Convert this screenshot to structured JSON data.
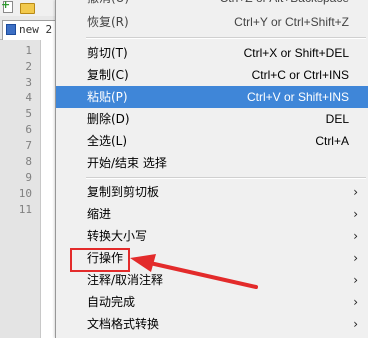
{
  "editor": {
    "tab_title": "new 2",
    "line_numbers": [
      "1",
      "2",
      "3",
      "4",
      "5",
      "6",
      "7",
      "8",
      "9",
      "10",
      "11"
    ]
  },
  "menu": {
    "items": [
      {
        "label": "撤消(U)",
        "shortcut": "Ctrl+Z or Alt+Backspace"
      },
      {
        "label": "恢复(R)",
        "shortcut": "Ctrl+Y or Ctrl+Shift+Z"
      },
      {
        "label": "剪切(T)",
        "shortcut": "Ctrl+X or Shift+DEL"
      },
      {
        "label": "复制(C)",
        "shortcut": "Ctrl+C or Ctrl+INS"
      },
      {
        "label": "粘贴(P)",
        "shortcut": "Ctrl+V or Shift+INS",
        "highlighted": true
      },
      {
        "label": "删除(D)",
        "shortcut": "DEL"
      },
      {
        "label": "全选(L)",
        "shortcut": "Ctrl+A"
      },
      {
        "label": "开始/结束 选择",
        "shortcut": ""
      },
      {
        "label": "复制到剪切板",
        "submenu": true
      },
      {
        "label": "缩进",
        "submenu": true
      },
      {
        "label": "转换大小写",
        "submenu": true
      },
      {
        "label": "行操作",
        "submenu": true
      },
      {
        "label": "注释/取消注释",
        "submenu": true
      },
      {
        "label": "自动完成",
        "submenu": true
      },
      {
        "label": "文档格式转换",
        "submenu": true
      }
    ],
    "submenu_glyph": "›"
  },
  "colors": {
    "highlight": "#3f86d8",
    "annotation": "#e32b2b"
  }
}
